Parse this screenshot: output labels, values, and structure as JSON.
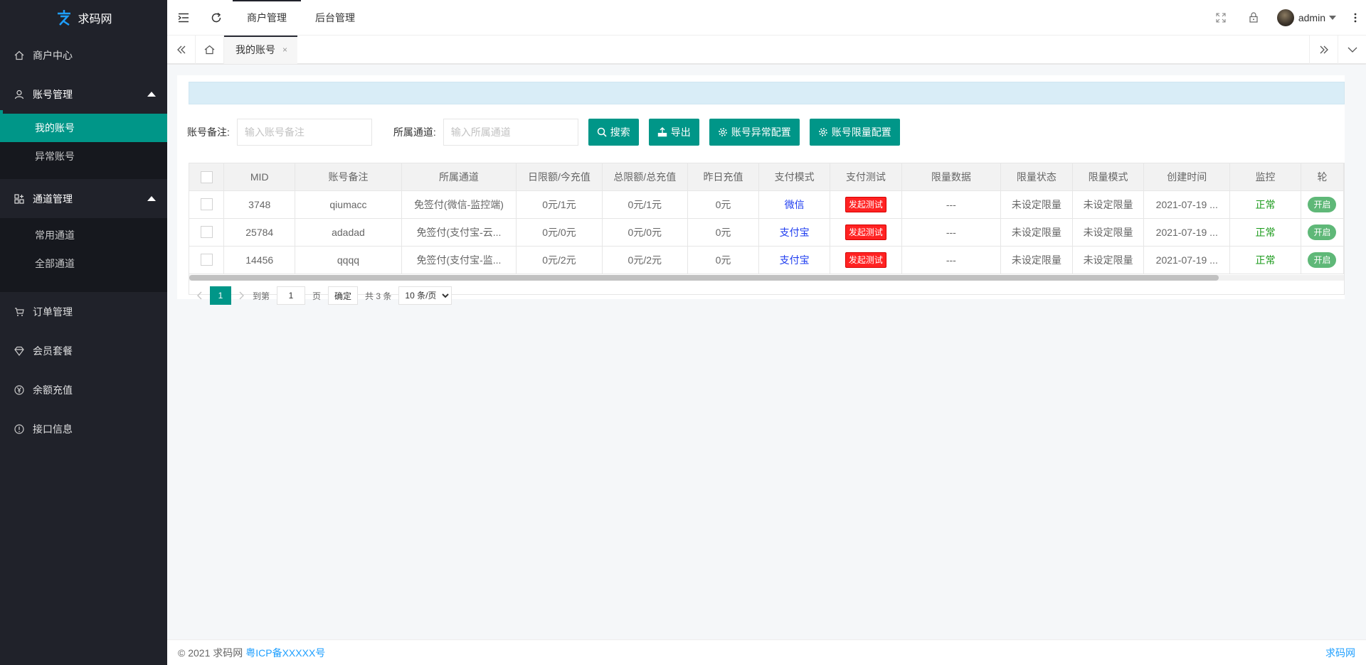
{
  "brand": {
    "name": "求码网"
  },
  "sidebar": {
    "items": [
      {
        "label": "商户中心"
      },
      {
        "label": "账号管理",
        "children": [
          "我的账号",
          "异常账号"
        ]
      },
      {
        "label": "通道管理",
        "children": [
          "常用通道",
          "全部通道"
        ]
      },
      {
        "label": "订单管理"
      },
      {
        "label": "会员套餐"
      },
      {
        "label": "余额充值"
      },
      {
        "label": "接口信息"
      }
    ]
  },
  "header": {
    "tabs": [
      "商户管理",
      "后台管理"
    ],
    "user": "admin"
  },
  "page_tabs": {
    "current": "我的账号",
    "close": "×"
  },
  "filters": {
    "remark_label": "账号备注:",
    "remark_placeholder": "输入账号备注",
    "channel_label": "所属通道:",
    "channel_placeholder": "输入所属通道",
    "buttons": [
      "搜索",
      "导出",
      "账号异常配置",
      "账号限量配置"
    ]
  },
  "table": {
    "columns": [
      "MID",
      "账号备注",
      "所属通道",
      "日限额/今充值",
      "总限额/总充值",
      "昨日充值",
      "支付模式",
      "支付测试",
      "限量数据",
      "限量状态",
      "限量模式",
      "创建时间",
      "监控",
      "轮"
    ],
    "rows": [
      {
        "mid": "3748",
        "remark": "qiumacc",
        "channel": "免签付(微信-监控端)",
        "daily": "0元/1元",
        "total": "0元/1元",
        "yesterday": "0元",
        "pay_mode": "微信",
        "test": "发起测试",
        "limit_data": "---",
        "limit_status": "未设定限量",
        "limit_mode": "未设定限量",
        "created": "2021-07-19 ...",
        "monitor": "正常",
        "toggle": "开启"
      },
      {
        "mid": "25784",
        "remark": "adadad",
        "channel": "免签付(支付宝-云...",
        "daily": "0元/0元",
        "total": "0元/0元",
        "yesterday": "0元",
        "pay_mode": "支付宝",
        "test": "发起测试",
        "limit_data": "---",
        "limit_status": "未设定限量",
        "limit_mode": "未设定限量",
        "created": "2021-07-19 ...",
        "monitor": "正常",
        "toggle": "开启"
      },
      {
        "mid": "14456",
        "remark": "qqqq",
        "channel": "免签付(支付宝-监...",
        "daily": "0元/2元",
        "total": "0元/2元",
        "yesterday": "0元",
        "pay_mode": "支付宝",
        "test": "发起测试",
        "limit_data": "---",
        "limit_status": "未设定限量",
        "limit_mode": "未设定限量",
        "created": "2021-07-19 ...",
        "monitor": "正常",
        "toggle": "开启"
      }
    ]
  },
  "pager": {
    "current": "1",
    "goto_label": "到第",
    "page_value": "1",
    "page_suffix": "页",
    "confirm": "确定",
    "total": "共 3 条",
    "page_size": "10 条/页"
  },
  "footer": {
    "copyright": "© 2021 求码网",
    "icp": "粤ICP备XXXXX号",
    "right": "求码网"
  },
  "colors": {
    "accent": "#009688",
    "sidebar": "#20222a",
    "danger": "#ff2222"
  }
}
